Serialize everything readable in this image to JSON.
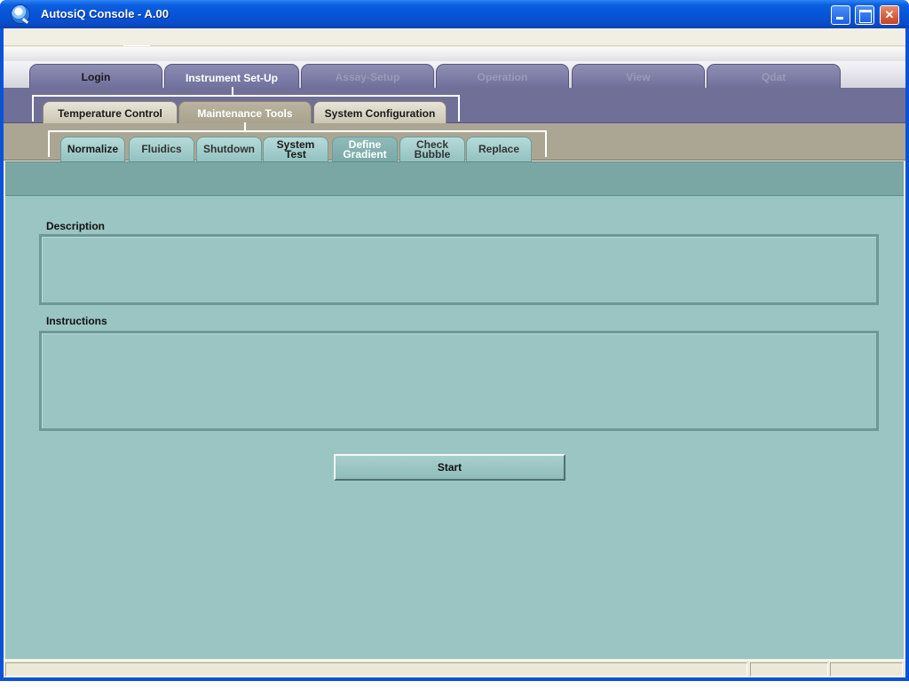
{
  "window": {
    "title": "AutosiQ Console - A.00",
    "controls": {
      "minimize": "minimize-icon",
      "maximize": "maximize-icon",
      "close": "✕"
    }
  },
  "main_tabs": [
    {
      "label": "Login"
    },
    {
      "label": "Instrument Set-Up"
    },
    {
      "label": "Assay-Setup"
    },
    {
      "label": "Operation"
    },
    {
      "label": "View"
    },
    {
      "label": "Qdat"
    }
  ],
  "sub_tabs": [
    {
      "label": "Temperature Control"
    },
    {
      "label": "Maintenance Tools"
    },
    {
      "label": "System Configuration"
    }
  ],
  "tool_tabs": [
    {
      "label": "Normalize"
    },
    {
      "label": "Fluidics"
    },
    {
      "label": "Shutdown"
    },
    {
      "line1": "System",
      "line2": "Test"
    },
    {
      "line1": "Define",
      "line2": "Gradient"
    },
    {
      "line1": "Check",
      "line2": "Bubble"
    },
    {
      "label": "Replace"
    }
  ],
  "content": {
    "description_label": "Description",
    "description_value": "",
    "instructions_label": "Instructions",
    "instructions_value": "",
    "start_label": "Start"
  },
  "colors": {
    "title_bar": "#0653d6",
    "main_tab": "#6e6e99",
    "sub_tab": "#c9c4b1",
    "tool_tab": "#93c2c1",
    "content": "#9ac5c3"
  }
}
